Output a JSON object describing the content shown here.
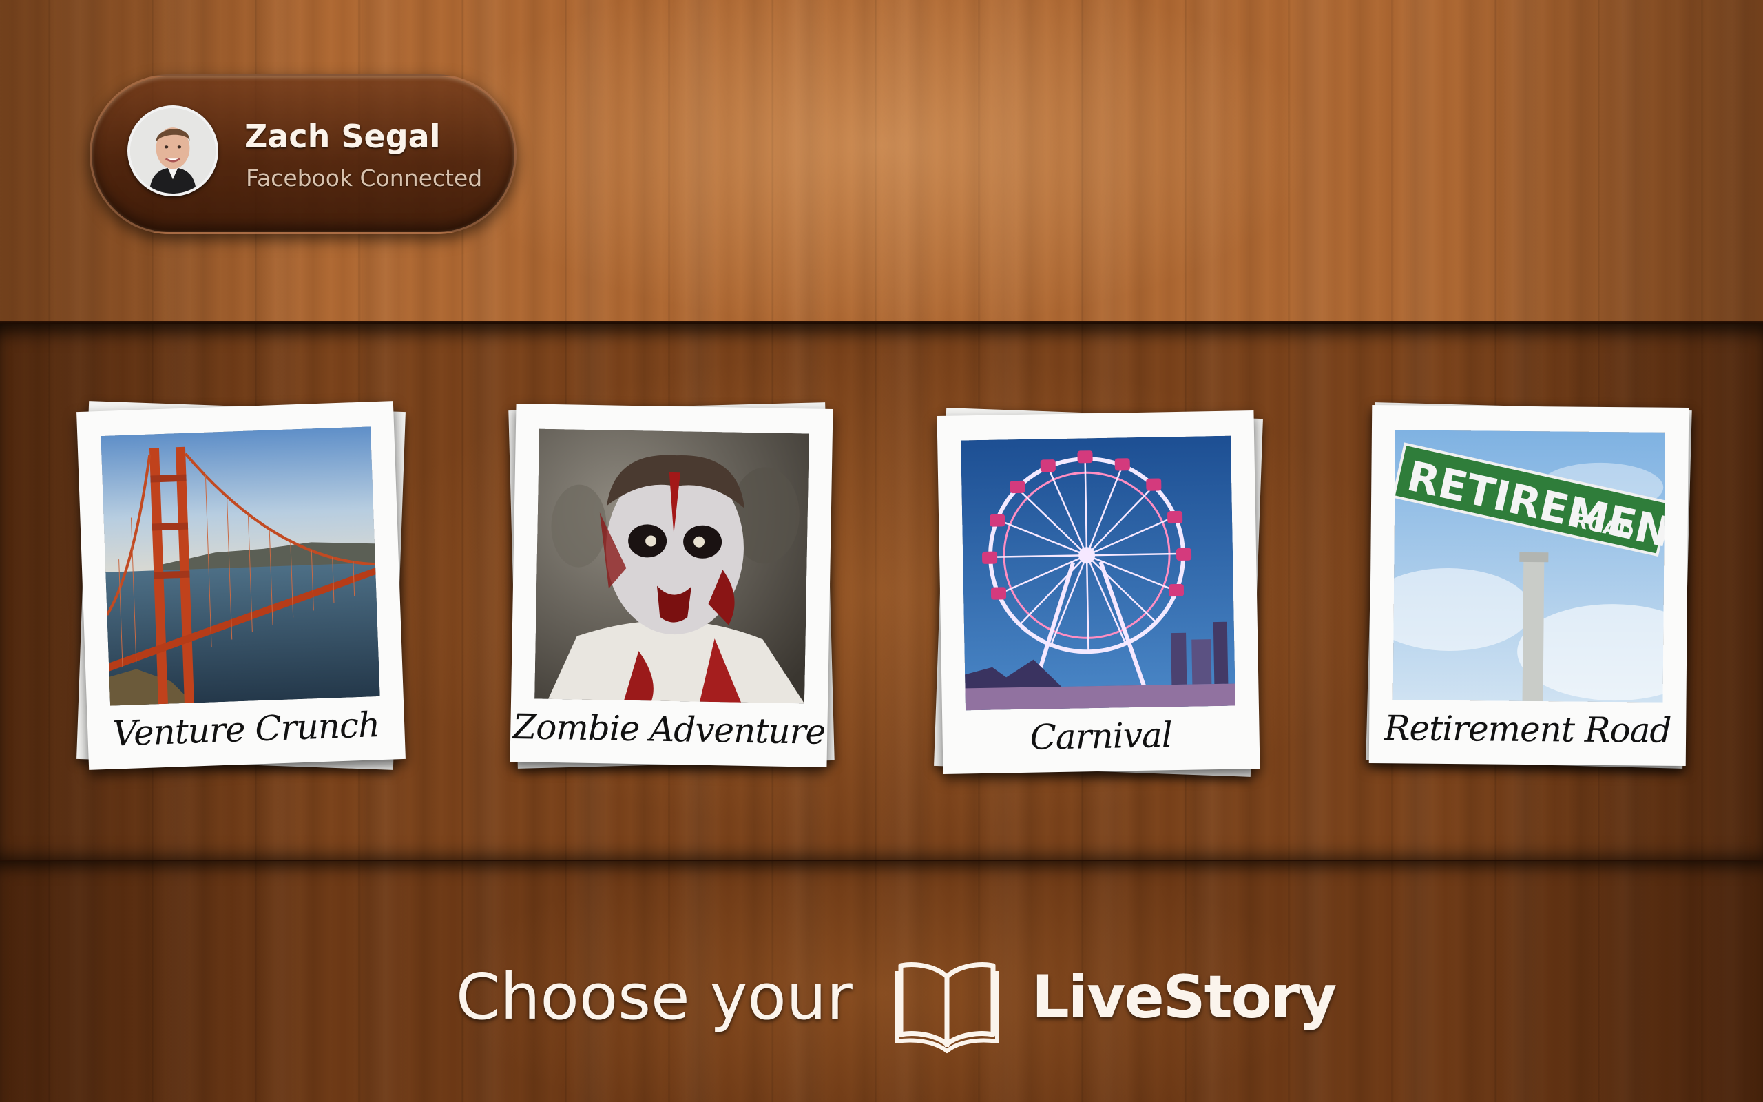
{
  "profile": {
    "name": "Zach Segal",
    "status": "Facebook Connected",
    "avatar_icon": "user-avatar"
  },
  "stories": [
    {
      "title": "Venture Crunch",
      "image": "golden-gate-bridge"
    },
    {
      "title": "Zombie Adventure",
      "image": "zombie-face"
    },
    {
      "title": "Carnival",
      "image": "ferris-wheel"
    },
    {
      "title": "Retirement Road",
      "image": "street-sign"
    }
  ],
  "signs": {
    "main": "RETIREMENT",
    "small": "ROAD"
  },
  "footer": {
    "prompt": "Choose your",
    "brand": "LiveStory",
    "brand_icon": "open-book-icon"
  },
  "colors": {
    "text_light": "#fbf4ec",
    "wood_light": "#b06a34",
    "wood_dark": "#7c441c"
  }
}
